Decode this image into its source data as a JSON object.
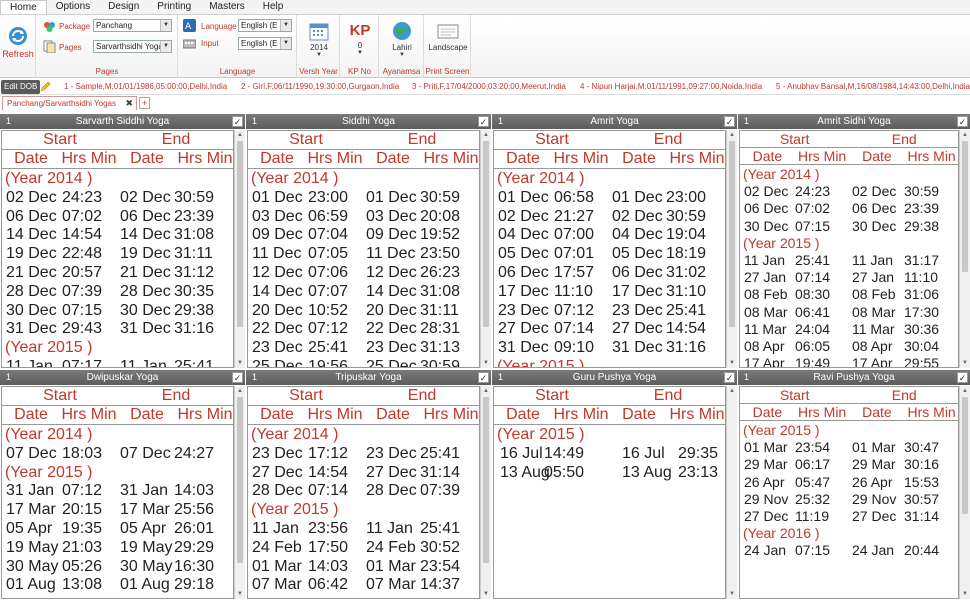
{
  "menu": [
    "Home",
    "Options",
    "Design",
    "Printing",
    "Masters",
    "Help"
  ],
  "ribbon": {
    "refresh_label": "Refresh",
    "package_label": "Package",
    "package_value": "Panchang",
    "pages_label": "Pages",
    "pages_value": "Sarvarthsidhi Yogas",
    "pages_group": "Pages",
    "language_label": "Language",
    "language_value": "English (E",
    "input_label": "Input",
    "input_value": "English (E",
    "language_group": "Language",
    "year_value": "2014",
    "year_label": "Versh Year",
    "kp_value": "0",
    "kp_label": "KP No",
    "kp_icon_text": "KP",
    "ayanamsa_value": "Lahiri",
    "ayanamsa_label": "Ayanamsa",
    "orientation_value": "Landscape",
    "print_label": "Print Screen"
  },
  "dob": {
    "edit_label": "Edit DOB",
    "items": [
      "1 - Sample,M,01/01/1986,05:00:00,Delhi,India",
      "2 - Girl,F,06/11/1990,19:30:00,Gurgaon,India",
      "3 - Priti,F,17/04/2000,03:20:00,Meerut,India",
      "4 - Nipun Harjai,M,01/11/1991,09:27:00,Noida,India",
      "5 - Anubhav Bansal,M,16/08/1984,14:43:00,Delhi,India"
    ]
  },
  "tab": {
    "label": "Panchang/Sarvarthsidhi Yogas",
    "close": "✖",
    "add": "+"
  },
  "headers": {
    "start": "Start",
    "end": "End",
    "date": "Date",
    "hrsmin": "Hrs Min"
  },
  "panels": [
    {
      "num": "1",
      "title": "Sarvarth Siddhi Yoga",
      "check": "✓",
      "rows": [
        {
          "yr": "(Year 2014 )"
        },
        {
          "d": [
            "02 Dec",
            "24:23",
            "02 Dec",
            "30:59"
          ]
        },
        {
          "d": [
            "06 Dec",
            "07:02",
            "06 Dec",
            "23:39"
          ]
        },
        {
          "d": [
            "14 Dec",
            "14:54",
            "14 Dec",
            "31:08"
          ]
        },
        {
          "d": [
            "19 Dec",
            "22:48",
            "19 Dec",
            "31:11"
          ]
        },
        {
          "d": [
            "21 Dec",
            "20:57",
            "21 Dec",
            "31:12"
          ]
        },
        {
          "d": [
            "28 Dec",
            "07:39",
            "28 Dec",
            "30:35"
          ]
        },
        {
          "d": [
            "30 Dec",
            "07:15",
            "30 Dec",
            "29:38"
          ]
        },
        {
          "d": [
            "31 Dec",
            "29:43",
            "31 Dec",
            "31:16"
          ]
        },
        {
          "yr": "(Year 2015 )"
        },
        {
          "d": [
            "11 Jan",
            "07:17",
            "11 Jan",
            "25:41"
          ]
        }
      ]
    },
    {
      "num": "1",
      "title": "Siddhi Yoga",
      "check": "✓",
      "rows": [
        {
          "yr": "(Year 2014 )"
        },
        {
          "d": [
            "01 Dec",
            "23:00",
            "01 Dec",
            "30:59"
          ]
        },
        {
          "d": [
            "03 Dec",
            "06:59",
            "03 Dec",
            "20:08"
          ]
        },
        {
          "d": [
            "09 Dec",
            "07:04",
            "09 Dec",
            "19:52"
          ]
        },
        {
          "d": [
            "11 Dec",
            "07:05",
            "11 Dec",
            "23:50"
          ]
        },
        {
          "d": [
            "12 Dec",
            "07:06",
            "12 Dec",
            "26:23"
          ]
        },
        {
          "d": [
            "14 Dec",
            "07:07",
            "14 Dec",
            "31:08"
          ]
        },
        {
          "d": [
            "20 Dec",
            "10:52",
            "20 Dec",
            "31:11"
          ]
        },
        {
          "d": [
            "22 Dec",
            "07:12",
            "22 Dec",
            "28:31"
          ]
        },
        {
          "d": [
            "23 Dec",
            "25:41",
            "23 Dec",
            "31:13"
          ]
        },
        {
          "d": [
            "25 Dec",
            "19:56",
            "25 Dec",
            "30:59"
          ]
        }
      ]
    },
    {
      "num": "1",
      "title": "Amrit Yoga",
      "check": "✓",
      "rows": [
        {
          "yr": "(Year 2014 )"
        },
        {
          "d": [
            "01 Dec",
            "06:58",
            "01 Dec",
            "23:00"
          ]
        },
        {
          "d": [
            "02 Dec",
            "21:27",
            "02 Dec",
            "30:59"
          ]
        },
        {
          "d": [
            "04 Dec",
            "07:00",
            "04 Dec",
            "19:04"
          ]
        },
        {
          "d": [
            "05 Dec",
            "07:01",
            "05 Dec",
            "18:19"
          ]
        },
        {
          "d": [
            "06 Dec",
            "17:57",
            "06 Dec",
            "31:02"
          ]
        },
        {
          "d": [
            "17 Dec",
            "11:10",
            "17 Dec",
            "31:10"
          ]
        },
        {
          "d": [
            "23 Dec",
            "07:12",
            "23 Dec",
            "25:41"
          ]
        },
        {
          "d": [
            "27 Dec",
            "07:14",
            "27 Dec",
            "14:54"
          ]
        },
        {
          "d": [
            "31 Dec",
            "09:10",
            "31 Dec",
            "31:16"
          ]
        },
        {
          "yr": "(Year 2015 )"
        }
      ]
    },
    {
      "num": "1",
      "title": "Amrit Sidhi Yoga",
      "check": "✓",
      "rows": [
        {
          "yr": "(Year 2014 )"
        },
        {
          "d": [
            "02 Dec",
            "24:23",
            "02 Dec",
            "30:59"
          ]
        },
        {
          "d": [
            "06 Dec",
            "07:02",
            "06 Dec",
            "23:39"
          ]
        },
        {
          "d": [
            "30 Dec",
            "07:15",
            "30 Dec",
            "29:38"
          ]
        },
        {
          "yr": "(Year 2015 )"
        },
        {
          "d": [
            "11 Jan",
            "25:41",
            "11 Jan",
            "31:17"
          ]
        },
        {
          "d": [
            "27 Jan",
            "07:14",
            "27 Jan",
            "11:10"
          ]
        },
        {
          "d": [
            "08 Feb",
            "08:30",
            "08 Feb",
            "31:06"
          ]
        },
        {
          "d": [
            "08 Mar",
            "06:41",
            "08 Mar",
            "17:30"
          ]
        },
        {
          "d": [
            "11 Mar",
            "24:04",
            "11 Mar",
            "30:36"
          ]
        },
        {
          "d": [
            "08 Apr",
            "06:05",
            "08 Apr",
            "30:04"
          ]
        },
        {
          "d": [
            "17 Apr",
            "19:49",
            "17 Apr",
            "29:55"
          ]
        }
      ]
    },
    {
      "num": "1",
      "title": "Dwipuskar Yoga",
      "check": "✓",
      "rows": [
        {
          "yr": "(Year 2014 )"
        },
        {
          "d": [
            "07 Dec",
            "18:03",
            "07 Dec",
            "24:27"
          ]
        },
        {
          "yr": "(Year 2015 )"
        },
        {
          "d": [
            "31 Jan",
            "07:12",
            "31 Jan",
            "14:03"
          ]
        },
        {
          "d": [
            "17 Mar",
            "20:15",
            "17 Mar",
            "25:56"
          ]
        },
        {
          "d": [
            "05 Apr",
            "19:35",
            "05 Apr",
            "26:01"
          ]
        },
        {
          "d": [
            "19 May",
            "21:03",
            "19 May",
            "29:29"
          ]
        },
        {
          "d": [
            "30 May",
            "05:26",
            "30 May",
            "16:30"
          ]
        },
        {
          "d": [
            "01 Aug",
            "13:08",
            "01 Aug",
            "29:18"
          ]
        }
      ]
    },
    {
      "num": "1",
      "title": "Tripuskar Yoga",
      "check": "✓",
      "rows": [
        {
          "yr": "(Year 2014 )"
        },
        {
          "d": [
            "23 Dec",
            "17:12",
            "23 Dec",
            "25:41"
          ]
        },
        {
          "d": [
            "27 Dec",
            "14:54",
            "27 Dec",
            "31:14"
          ]
        },
        {
          "d": [
            "28 Dec",
            "07:14",
            "28 Dec",
            "07:39"
          ]
        },
        {
          "yr": "(Year 2015 )"
        },
        {
          "d": [
            "11 Jan",
            "23:56",
            "11 Jan",
            "25:41"
          ]
        },
        {
          "d": [
            "24 Feb",
            "17:50",
            "24 Feb",
            "30:52"
          ]
        },
        {
          "d": [
            "01 Mar",
            "14:03",
            "01 Mar",
            "23:54"
          ]
        },
        {
          "d": [
            "07 Mar",
            "06:42",
            "07 Mar",
            "14:37"
          ]
        }
      ]
    },
    {
      "num": "1",
      "title": "Guru Pushya Yoga",
      "check": "✓",
      "rows": [
        {
          "yr": "(Year 2015 )"
        },
        {
          "d": [
            "16 Jul",
            "14:49",
            "16 Jul",
            "29:35"
          ]
        },
        {
          "d": [
            "13 Aug",
            "05:50",
            "13 Aug",
            "23:13"
          ]
        }
      ]
    },
    {
      "num": "1",
      "title": "Ravi Pushya Yoga",
      "check": "✓",
      "rows": [
        {
          "yr": "(Year 2015 )"
        },
        {
          "d": [
            "01 Mar",
            "23:54",
            "01 Mar",
            "30:47"
          ]
        },
        {
          "d": [
            "29 Mar",
            "06:17",
            "29 Mar",
            "30:16"
          ]
        },
        {
          "d": [
            "26 Apr",
            "05:47",
            "26 Apr",
            "15:53"
          ]
        },
        {
          "d": [
            "29 Nov",
            "25:32",
            "29 Nov",
            "30:57"
          ]
        },
        {
          "d": [
            "27 Dec",
            "11:19",
            "27 Dec",
            "31:14"
          ]
        },
        {
          "yr": "(Year 2016 )"
        },
        {
          "d": [
            "24 Jan",
            "07:15",
            "24 Jan",
            "20:44"
          ]
        }
      ]
    }
  ]
}
